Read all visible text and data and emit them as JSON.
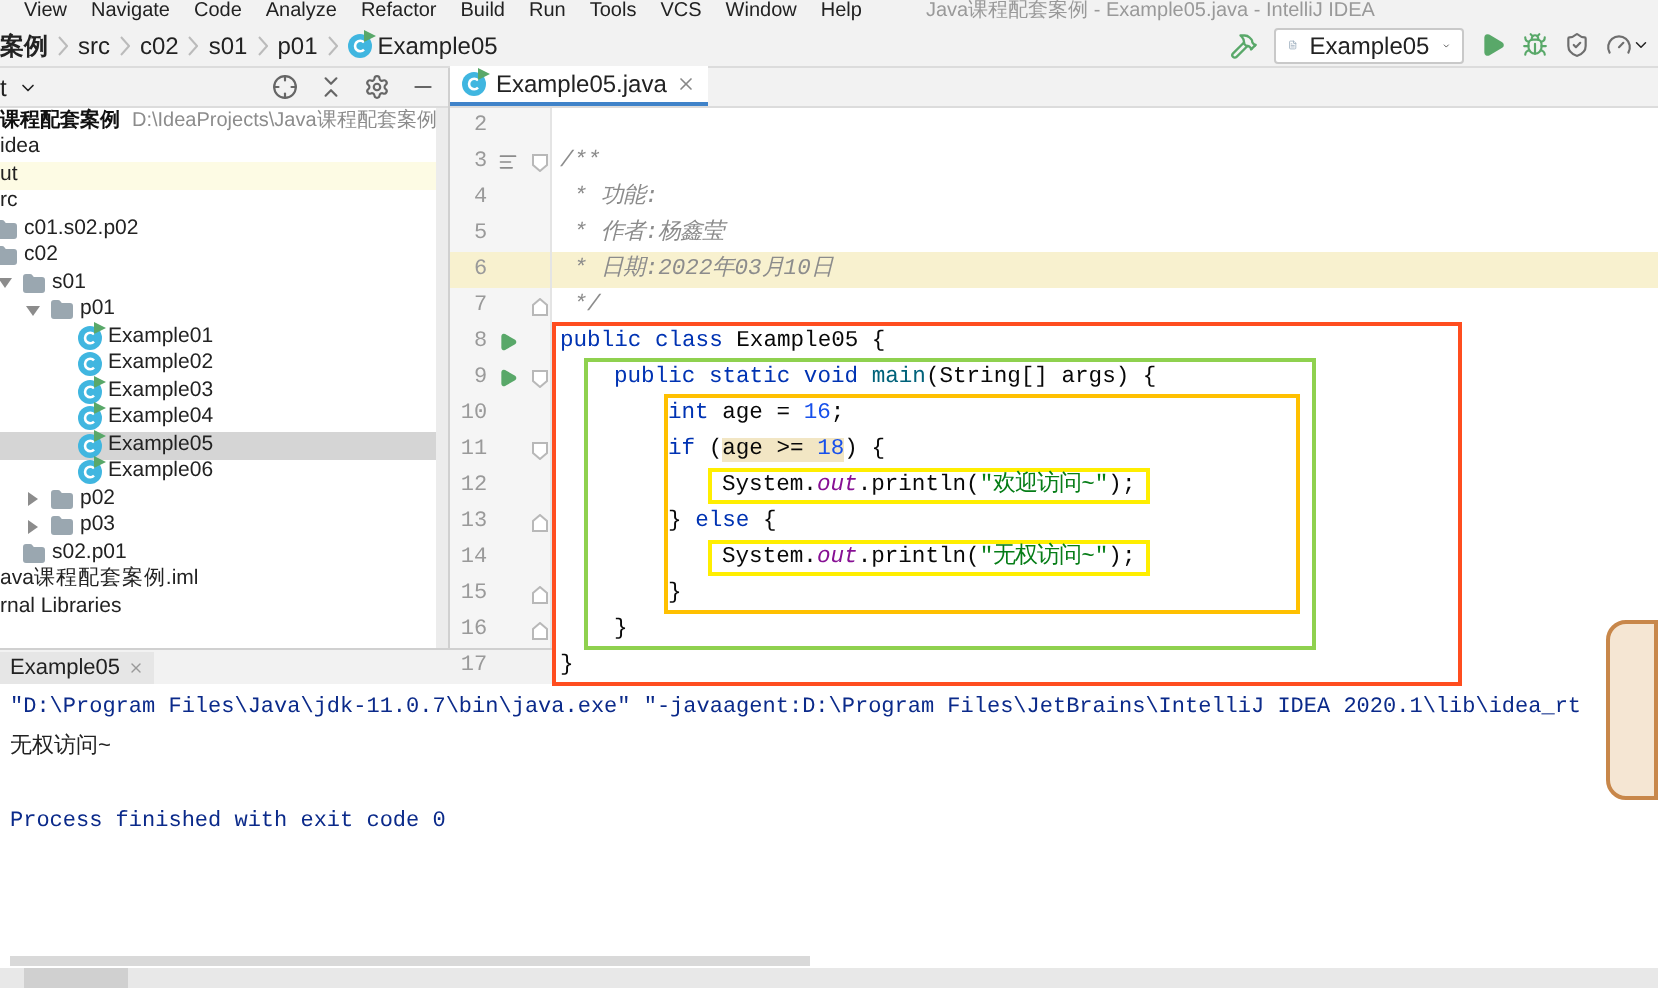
{
  "menu_bar": {
    "items": [
      "View",
      "Navigate",
      "Code",
      "Analyze",
      "Refactor",
      "Build",
      "Run",
      "Tools",
      "VCS",
      "Window",
      "Help"
    ],
    "title": "Java课程配套案例 - Example05.java - IntelliJ IDEA"
  },
  "breadcrumbs": [
    {
      "label": "案例",
      "kind": "module"
    },
    {
      "label": "src",
      "kind": "folder"
    },
    {
      "label": "c02",
      "kind": "folder"
    },
    {
      "label": "s01",
      "kind": "folder"
    },
    {
      "label": "p01",
      "kind": "folder"
    },
    {
      "label": "Example05",
      "kind": "class"
    }
  ],
  "run_toolbar": {
    "configuration": "Example05"
  },
  "project_panel": {
    "title": "t",
    "tree": [
      {
        "label": "课程配套案例",
        "path": "D:\\IdeaProjects\\Java课程配套案例",
        "kind": "module",
        "selected": false,
        "children": [
          {
            "label": "idea",
            "kind": "folder",
            "selected": false
          },
          {
            "label": "ut",
            "kind": "excluded_folder",
            "selected": false
          },
          {
            "label": "rc",
            "kind": "folder",
            "selected": false,
            "children": [
              {
                "label": "c01.s02.p02",
                "kind": "package",
                "selected": false
              },
              {
                "label": "c02",
                "kind": "package",
                "selected": false,
                "children": [
                  {
                    "label": "s01",
                    "kind": "package",
                    "expanded": true,
                    "selected": false,
                    "children": [
                      {
                        "label": "p01",
                        "kind": "package",
                        "expanded": true,
                        "selected": false,
                        "children": [
                          {
                            "label": "Example01",
                            "kind": "class",
                            "runnable": true,
                            "selected": false
                          },
                          {
                            "label": "Example02",
                            "kind": "class",
                            "runnable": false,
                            "selected": false
                          },
                          {
                            "label": "Example03",
                            "kind": "class",
                            "runnable": true,
                            "selected": false
                          },
                          {
                            "label": "Example04",
                            "kind": "class",
                            "runnable": true,
                            "selected": false
                          },
                          {
                            "label": "Example05",
                            "kind": "class",
                            "runnable": true,
                            "selected": true
                          },
                          {
                            "label": "Example06",
                            "kind": "class",
                            "runnable": true,
                            "selected": false
                          }
                        ]
                      },
                      {
                        "label": "p02",
                        "kind": "package",
                        "expanded": false,
                        "selected": false
                      },
                      {
                        "label": "p03",
                        "kind": "package",
                        "expanded": false,
                        "selected": false
                      }
                    ]
                  },
                  {
                    "label": "s02.p01",
                    "kind": "package",
                    "selected": false
                  }
                ]
              }
            ]
          },
          {
            "label": "ava课程配套案例.iml",
            "kind": "file",
            "selected": false
          },
          {
            "label": "rnal Libraries",
            "kind": "library",
            "selected": false
          }
        ]
      }
    ]
  },
  "editor": {
    "tabs": [
      {
        "label": "Example05.java",
        "selected": true
      }
    ],
    "code": [
      {
        "kind": "line",
        "number": "2",
        "current": false
      },
      {
        "kind": "line",
        "number": "3",
        "current": false,
        "gutter": [
          {
            "kind": "structure"
          },
          {
            "kind": "fold"
          }
        ],
        "tokens": [
          {
            "kind": "comment",
            "text": "/**"
          }
        ]
      },
      {
        "kind": "line",
        "number": "4",
        "current": false,
        "tokens": [
          {
            "kind": "comment",
            "text": " * 功能:"
          }
        ]
      },
      {
        "kind": "line",
        "number": "5",
        "current": false,
        "tokens": [
          {
            "kind": "comment",
            "text": " * 作者:杨鑫莹"
          }
        ]
      },
      {
        "kind": "line",
        "number": "6",
        "current": true,
        "tokens": [
          {
            "kind": "comment",
            "text": " * 日期:2022年03月10日"
          }
        ]
      },
      {
        "kind": "line",
        "number": "7",
        "current": false,
        "gutter": [
          {
            "kind": "fold_end"
          }
        ],
        "tokens": [
          {
            "kind": "comment",
            "text": " */"
          }
        ]
      },
      {
        "kind": "box",
        "color": "#ff4d1f",
        "items": [
          {
            "kind": "line",
            "number": "8",
            "current": false,
            "gutter": [
              {
                "kind": "run"
              }
            ],
            "tokens": [
              {
                "kind": "keyword",
                "text": "public class "
              },
              {
                "kind": "plain",
                "text": "Example05 {"
              }
            ]
          },
          {
            "kind": "box",
            "color": "#8fd14f",
            "items": [
              {
                "kind": "line",
                "number": "9",
                "current": false,
                "gutter": [
                  {
                    "kind": "run"
                  },
                  {
                    "kind": "fold"
                  }
                ],
                "tokens": [
                  {
                    "kind": "keyword",
                    "text": "public static void "
                  },
                  {
                    "kind": "method",
                    "text": "main"
                  },
                  {
                    "kind": "plain",
                    "text": "(String[] args) {"
                  }
                ]
              },
              {
                "kind": "box",
                "color": "#ffc000",
                "items": [
                  {
                    "kind": "line",
                    "number": "10",
                    "current": false,
                    "tokens": [
                      {
                        "kind": "keyword",
                        "text": "int "
                      },
                      {
                        "kind": "plain",
                        "text": "age = "
                      },
                      {
                        "kind": "number",
                        "text": "16"
                      },
                      {
                        "kind": "plain",
                        "text": ";"
                      }
                    ]
                  },
                  {
                    "kind": "line",
                    "number": "11",
                    "current": false,
                    "gutter": [
                      {
                        "kind": "fold"
                      }
                    ],
                    "tokens": [
                      {
                        "kind": "keyword",
                        "text": "if "
                      },
                      {
                        "kind": "plain",
                        "text": "("
                      },
                      {
                        "kind": "highlight",
                        "tokens": [
                          {
                            "kind": "plain",
                            "text": "age >= "
                          },
                          {
                            "kind": "number",
                            "text": "18"
                          }
                        ]
                      },
                      {
                        "kind": "plain",
                        "text": ") {"
                      }
                    ]
                  },
                  {
                    "kind": "line",
                    "number": "12",
                    "current": false,
                    "frame": {
                      "color": "#ffee00"
                    },
                    "tokens": [
                      {
                        "kind": "plain",
                        "text": "System."
                      },
                      {
                        "kind": "field",
                        "text": "out"
                      },
                      {
                        "kind": "plain",
                        "text": ".println("
                      },
                      {
                        "kind": "string",
                        "text": "\"欢迎访问~\""
                      },
                      {
                        "kind": "plain",
                        "text": ");"
                      }
                    ]
                  },
                  {
                    "kind": "line",
                    "number": "13",
                    "current": false,
                    "gutter": [
                      {
                        "kind": "fold_end"
                      }
                    ],
                    "tokens": [
                      {
                        "kind": "plain",
                        "text": "} "
                      },
                      {
                        "kind": "keyword",
                        "text": "else "
                      },
                      {
                        "kind": "plain",
                        "text": "{"
                      }
                    ]
                  },
                  {
                    "kind": "line",
                    "number": "14",
                    "current": false,
                    "frame": {
                      "color": "#ffee00"
                    },
                    "tokens": [
                      {
                        "kind": "plain",
                        "text": "System."
                      },
                      {
                        "kind": "field",
                        "text": "out"
                      },
                      {
                        "kind": "plain",
                        "text": ".println("
                      },
                      {
                        "kind": "string",
                        "text": "\"无权访问~\""
                      },
                      {
                        "kind": "plain",
                        "text": ");"
                      }
                    ]
                  },
                  {
                    "kind": "line",
                    "number": "15",
                    "current": false,
                    "gutter": [
                      {
                        "kind": "fold_end"
                      }
                    ],
                    "tokens": [
                      {
                        "kind": "plain",
                        "text": "}"
                      }
                    ]
                  }
                ]
              },
              {
                "kind": "line",
                "number": "16",
                "current": false,
                "gutter": [
                  {
                    "kind": "fold_end"
                  }
                ],
                "tokens": [
                  {
                    "kind": "plain",
                    "text": "}"
                  }
                ]
              }
            ]
          },
          {
            "kind": "line",
            "number": "17",
            "current": false,
            "tokens": [
              {
                "kind": "plain",
                "text": "}"
              }
            ]
          }
        ]
      }
    ]
  },
  "run_panel": {
    "tabs": [
      {
        "label": "Example05",
        "selected": true
      }
    ],
    "output": [
      {
        "kind": "system",
        "text": "\"D:\\Program Files\\Java\\jdk-11.0.7\\bin\\java.exe\" \"-javaagent:D:\\Program Files\\JetBrains\\IntelliJ IDEA 2020.1\\lib\\idea_rt"
      },
      {
        "kind": "stdout",
        "text": "无权访问~"
      },
      {
        "kind": "system",
        "text": "Process finished with exit code 0"
      }
    ]
  }
}
